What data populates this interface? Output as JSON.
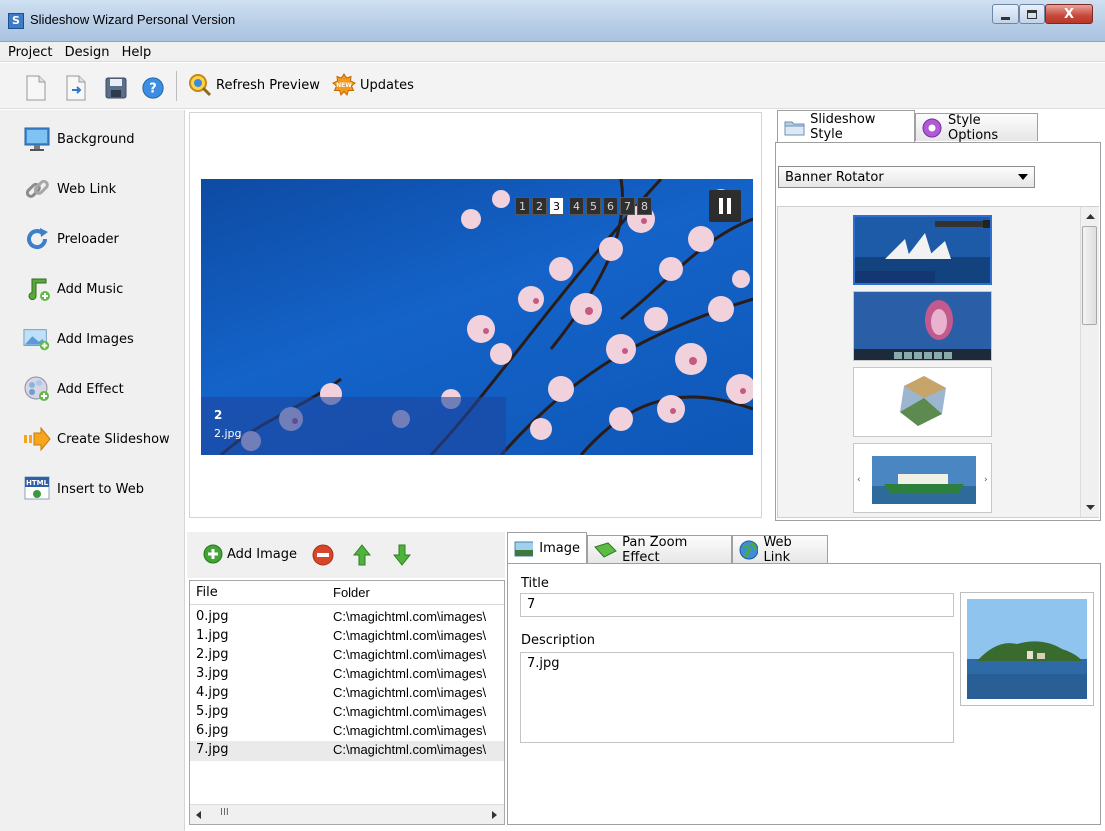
{
  "window": {
    "title": "Slideshow Wizard Personal Version",
    "app_icon_letter": "S",
    "close_glyph": "X"
  },
  "menu": {
    "items": [
      "Project",
      "Design",
      "Help"
    ]
  },
  "toolbar": {
    "refresh_label": "Refresh Preview",
    "updates_label": "Updates",
    "new_badge": "NEW"
  },
  "sidebar": {
    "items": [
      {
        "label": "Background",
        "icon": "monitor-icon"
      },
      {
        "label": "Web Link",
        "icon": "chain-link-icon"
      },
      {
        "label": "Preloader",
        "icon": "refresh-arrow-icon"
      },
      {
        "label": "Add Music",
        "icon": "music-note-icon"
      },
      {
        "label": "Add Images",
        "icon": "add-image-icon"
      },
      {
        "label": "Add Effect",
        "icon": "add-effect-icon"
      },
      {
        "label": "Create Slideshow",
        "icon": "right-arrow-icon"
      },
      {
        "label": "Insert to Web",
        "icon": "html-icon"
      }
    ]
  },
  "preview": {
    "numbers": [
      "1",
      "2",
      "3",
      "4",
      "5",
      "6",
      "7",
      "8"
    ],
    "active_number": "3",
    "caption_title": "2",
    "caption_desc": "2.jpg"
  },
  "style_panel": {
    "tabs": [
      "Slideshow Style",
      "Style Options"
    ],
    "selected_style": "Banner Rotator"
  },
  "image_toolbar": {
    "add_label": "Add Image"
  },
  "file_list": {
    "columns": [
      "File",
      "Folder"
    ],
    "rows": [
      {
        "file": "0.jpg",
        "folder": "C:\\magichtml.com\\images\\"
      },
      {
        "file": "1.jpg",
        "folder": "C:\\magichtml.com\\images\\"
      },
      {
        "file": "2.jpg",
        "folder": "C:\\magichtml.com\\images\\"
      },
      {
        "file": "3.jpg",
        "folder": "C:\\magichtml.com\\images\\"
      },
      {
        "file": "4.jpg",
        "folder": "C:\\magichtml.com\\images\\"
      },
      {
        "file": "5.jpg",
        "folder": "C:\\magichtml.com\\images\\"
      },
      {
        "file": "6.jpg",
        "folder": "C:\\magichtml.com\\images\\"
      },
      {
        "file": "7.jpg",
        "folder": "C:\\magichtml.com\\images\\"
      }
    ],
    "selected_index": 7,
    "scroll_grip": "III"
  },
  "detail": {
    "tabs": [
      "Image",
      "Pan Zoom Effect",
      "Web Link"
    ],
    "title_label": "Title",
    "title_value": "7",
    "description_label": "Description",
    "description_value": "7.jpg"
  }
}
